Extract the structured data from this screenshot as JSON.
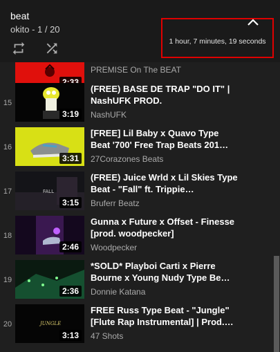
{
  "header": {
    "title": "beat",
    "subtitle": "okito - 1 / 20",
    "total_duration": "1 hour, 7 minutes, 19 seconds"
  },
  "icons": {
    "loop": "loop-icon",
    "shuffle": "shuffle-icon",
    "collapse": "chevron-up-icon"
  },
  "colors": {
    "highlight_box": "#e00000",
    "background": "#1f1f1f"
  },
  "playlist": {
    "partial_item": {
      "duration": "2:33",
      "channel": "PREMISE On The BEAT"
    },
    "items": [
      {
        "index": "15",
        "title": "(FREE) BASE DE TRAP \"DO IT\" | NashUFK PROD.",
        "channel": "NashUFK",
        "duration": "3:19"
      },
      {
        "index": "16",
        "title": "[FREE] Lil Baby x Quavo Type Beat '700' Free Trap Beats 201…",
        "channel": "27Corazones Beats",
        "duration": "3:31"
      },
      {
        "index": "17",
        "title": "(FREE) Juice Wrld x Lil Skies Type Beat - \"Fall\" ft. Trippie…",
        "channel": "Bruferr Beatz",
        "duration": "3:15"
      },
      {
        "index": "18",
        "title": "Gunna x Future x Offset - Finesse [prod. woodpecker]",
        "channel": "Woodpecker",
        "duration": "2:46"
      },
      {
        "index": "19",
        "title": "*SOLD* Playboi Carti x Pierre Bourne x Young Nudy Type Be…",
        "channel": "Donnie Katana",
        "duration": "2:36"
      },
      {
        "index": "20",
        "title": "FREE Russ Type Beat - \"Jungle\" [Flute Rap Instrumental] | Prod.…",
        "channel": "47 Shots",
        "duration": "3:13"
      }
    ],
    "thumb_text": {
      "fall": "FALL",
      "jungle": "JUNGLE"
    }
  }
}
